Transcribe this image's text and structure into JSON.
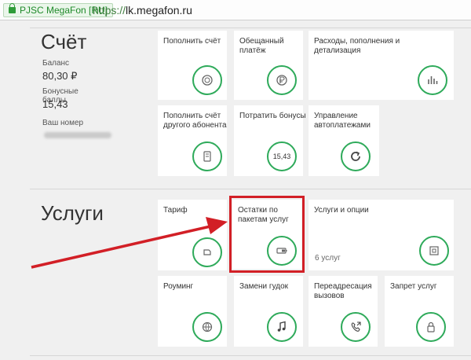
{
  "browser": {
    "site_badge": "PJSC MegaFon [RU]",
    "url_scheme": "https://",
    "url_rest": "lk.megafon.ru"
  },
  "account": {
    "title": "Счёт",
    "balance_label": "Баланс",
    "balance_value": "80,30 ₽",
    "bonus_label_1": "Бонусные",
    "bonus_label_2": "баллы",
    "bonus_value": "15,43",
    "number_label": "Ваш номер"
  },
  "services_title": "Услуги",
  "tiles": {
    "topup": "Пополнить счёт",
    "promised": "Обещанный платёж",
    "expenses": "Расходы, пополнения и детализация",
    "topup_other": "Пополнить счёт другого абонента",
    "spend_bonus": "Потратить бонусы",
    "bonus_amount": "15,43",
    "autopay": "Управление автоплатежами",
    "tariff": "Тариф",
    "remainders": "Остатки по пакетам услуг",
    "services_options": "Услуги и опции",
    "services_count": "6 услуг",
    "roaming": "Роуминг",
    "ringback": "Замени гудок",
    "forwarding": "Переадресация вызовов",
    "barring": "Запрет услуг"
  },
  "colors": {
    "accent": "#2eaa5a",
    "highlight": "#d21f26",
    "background": "#f0f0f0"
  }
}
